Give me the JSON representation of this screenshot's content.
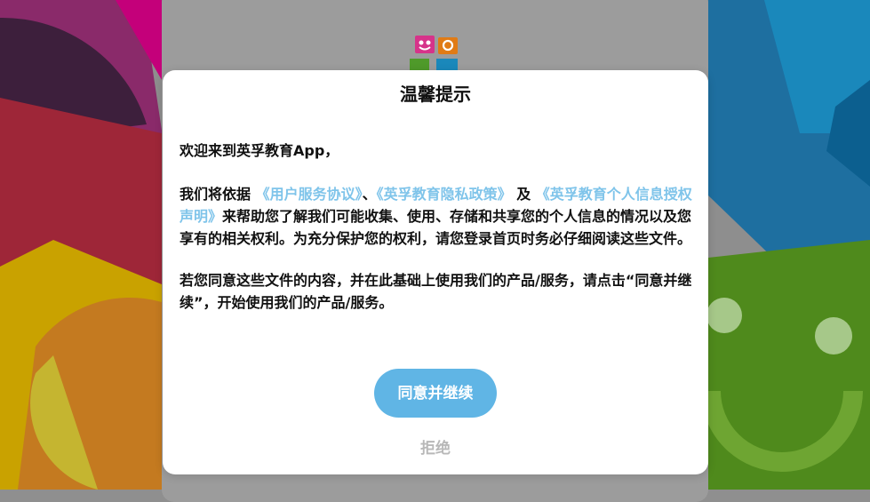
{
  "dialog": {
    "title": "温馨提示",
    "welcome": "欢迎来到英孚教育App，",
    "p2_intro": "我们将依据",
    "link_user_agreement": "《用户服务协议》",
    "sep1": "、",
    "link_privacy_policy": "《英孚教育隐私政策》",
    "and_word": " 及 ",
    "link_personal_info": "《英孚教育个人信息授权声明》",
    "p2_rest": "来帮助您了解我们可能收集、使用、存储和共享您的个人信息的情况以及您享有的相关权利。为充分保护您的权利，请您登录首页时务必仔细阅读这些文件。",
    "p3": "若您同意这些文件的内容，并在此基础上使用我们的产品/服务，请点击“同意并继续”，开始使用我们的产品/服务。",
    "agree_label": "同意并继续",
    "reject_label": "拒绝"
  },
  "colors": {
    "link": "#7fc4ea",
    "primary_button": "#60b5e5",
    "reject_text": "#b8b8b8"
  }
}
